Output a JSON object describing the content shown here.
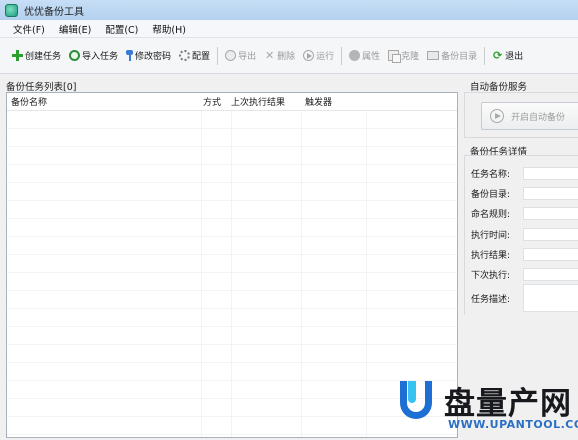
{
  "window": {
    "title": "优优备份工具"
  },
  "menu": [
    "文件(F)",
    "编辑(E)",
    "配置(C)",
    "帮助(H)"
  ],
  "toolbar": {
    "create": "创建任务",
    "import": "导入任务",
    "change_password": "修改密码",
    "config": "配置",
    "export": "导出",
    "delete": "删除",
    "run": "运行",
    "properties": "属性",
    "clone": "克隆",
    "backup_dir": "备份目录",
    "exit": "退出"
  },
  "task_list": {
    "title": "备份任务列表[0]",
    "columns": [
      "备份名称",
      "方式",
      "上次执行结果",
      "触发器"
    ],
    "rows": []
  },
  "auto_service": {
    "title": "自动备份服务",
    "button": "开启自动备份"
  },
  "details": {
    "title": "备份任务详情",
    "fields": [
      "任务名称:",
      "备份目录:",
      "命名规则:",
      "执行时间:",
      "执行结果:",
      "下次执行:",
      "任务描述:"
    ]
  },
  "watermark": {
    "brand": "盘量产网",
    "url": "WWW.UPANTOOL.COM"
  },
  "colors": {
    "watermark_blue": "#1e6fd3",
    "enabled_green": "#2ca02c",
    "disabled_gray": "#9a9a9a"
  }
}
